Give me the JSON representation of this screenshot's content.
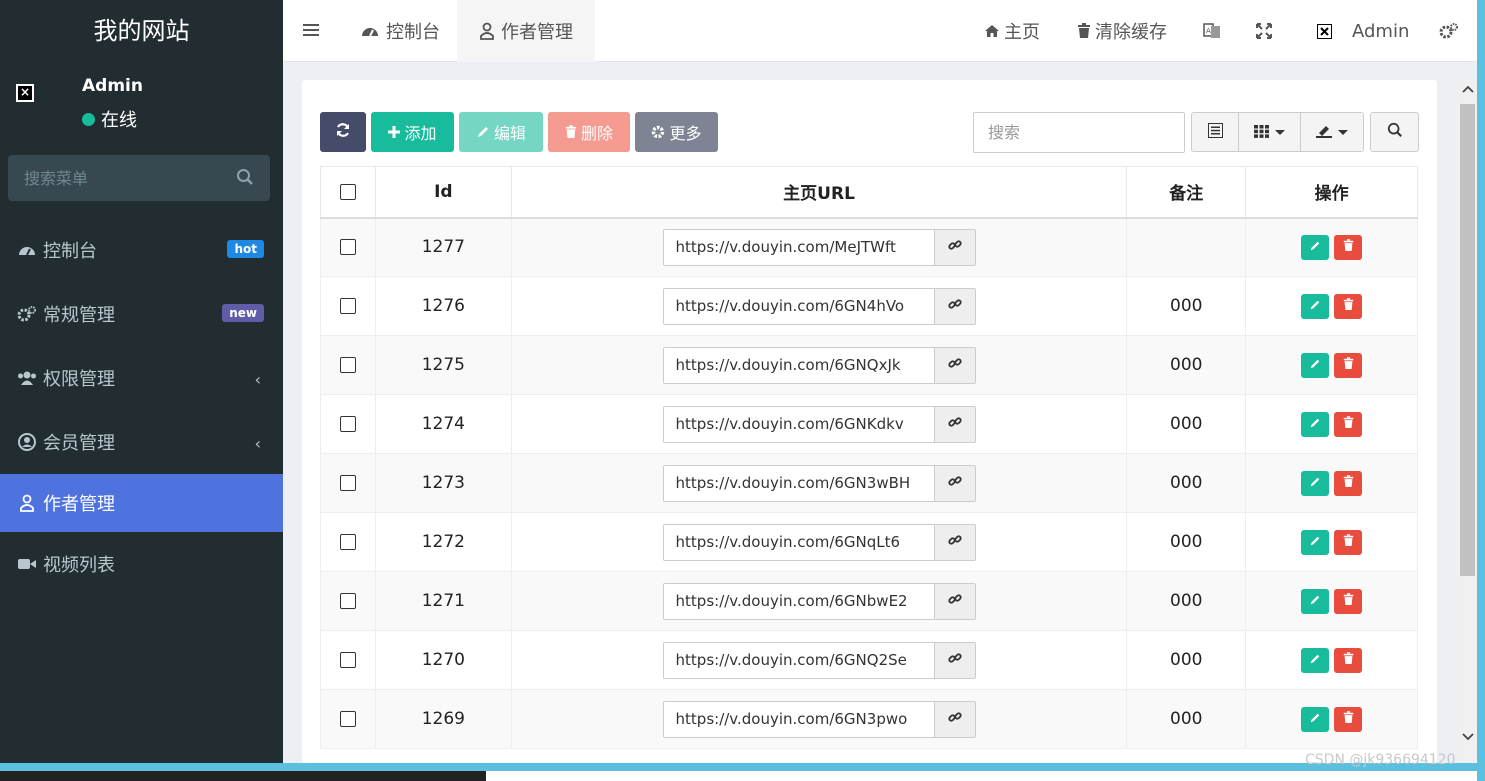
{
  "sidebar": {
    "brand": "我的网站",
    "user": {
      "name": "Admin",
      "status": "在线"
    },
    "search_placeholder": "搜索菜单",
    "items": [
      {
        "label": "控制台",
        "badge": "hot",
        "icon": "dashboard-icon"
      },
      {
        "label": "常规管理",
        "badge": "new",
        "icon": "cogs-icon"
      },
      {
        "label": "权限管理",
        "icon": "group-icon",
        "has_children": true
      },
      {
        "label": "会员管理",
        "icon": "user-circle-icon",
        "has_children": true
      },
      {
        "label": "作者管理",
        "icon": "user-icon",
        "active": true
      },
      {
        "label": "视频列表",
        "icon": "video-camera-icon"
      }
    ]
  },
  "header": {
    "tabs": [
      {
        "label": "控制台",
        "icon": "dashboard-icon"
      },
      {
        "label": "作者管理",
        "icon": "user-icon",
        "active": true
      }
    ],
    "home": "主页",
    "clear_cache": "清除缓存",
    "admin": "Admin"
  },
  "toolbar": {
    "add": "添加",
    "edit": "编辑",
    "delete": "删除",
    "more": "更多",
    "search_placeholder": "搜索"
  },
  "table": {
    "headers": {
      "id": "Id",
      "url": "主页URL",
      "note": "备注",
      "ops": "操作"
    },
    "rows": [
      {
        "id": "1277",
        "url": "https://v.douyin.com/MeJTWft",
        "note": ""
      },
      {
        "id": "1276",
        "url": "https://v.douyin.com/6GN4hVo",
        "note": "000"
      },
      {
        "id": "1275",
        "url": "https://v.douyin.com/6GNQxJk",
        "note": "000"
      },
      {
        "id": "1274",
        "url": "https://v.douyin.com/6GNKdkv",
        "note": "000"
      },
      {
        "id": "1273",
        "url": "https://v.douyin.com/6GN3wBH",
        "note": "000"
      },
      {
        "id": "1272",
        "url": "https://v.douyin.com/6GNqLt6",
        "note": "000"
      },
      {
        "id": "1271",
        "url": "https://v.douyin.com/6GNbwE2",
        "note": "000"
      },
      {
        "id": "1270",
        "url": "https://v.douyin.com/6GNQ2Se",
        "note": "000"
      },
      {
        "id": "1269",
        "url": "https://v.douyin.com/6GN3pwo",
        "note": "000"
      }
    ]
  },
  "watermark": "CSDN @jk936694120",
  "colors": {
    "sidebar_bg": "#222d32",
    "active": "#4e73df",
    "success": "#18bc9c",
    "danger": "#e74c3c"
  }
}
